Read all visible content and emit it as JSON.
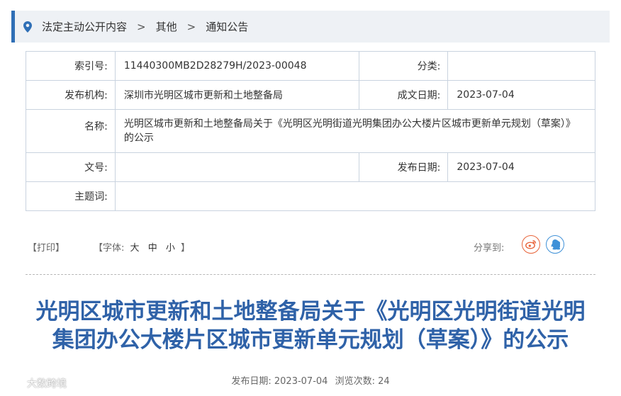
{
  "breadcrumb": {
    "items": [
      "法定主动公开内容",
      "其他",
      "通知公告"
    ],
    "separator": ">"
  },
  "meta": {
    "index_label": "索引号:",
    "index_value": "11440300MB2D28279H/2023-00048",
    "category_label": "分类:",
    "category_value": "",
    "publisher_label": "发布机构:",
    "publisher_value": "深圳市光明区城市更新和土地整备局",
    "created_label": "成文日期:",
    "created_value": "2023-07-04",
    "name_label": "名称:",
    "name_value": "光明区城市更新和土地整备局关于《光明区光明街道光明集团办公大楼片区城市更新单元规划（草案）》的公示",
    "docno_label": "文号:",
    "docno_value": "",
    "pubdate_label": "发布日期:",
    "pubdate_value": "2023-07-04",
    "subject_label": "主题词:",
    "subject_value": ""
  },
  "tools": {
    "print": "【打印】",
    "font_prefix": "【字体:",
    "font_large": "大",
    "font_medium": "中",
    "font_small": "小",
    "font_suffix": "】",
    "share_label": "分享到:"
  },
  "article": {
    "title_line1": "光明区城市更新和土地整备局关于《光明区光明街道光明",
    "title_line2": "集团办公大楼片区城市更新单元规划（草案）》的公示",
    "pub_label": "发布日期:",
    "pub_date": "2023-07-04",
    "views_label": "浏览次数:",
    "views": "24"
  },
  "watermark": "大数跨境",
  "colors": {
    "accent": "#2f6fb6",
    "title": "#2f62a8",
    "weibo": "#e8643a",
    "qq": "#3f91d8"
  }
}
